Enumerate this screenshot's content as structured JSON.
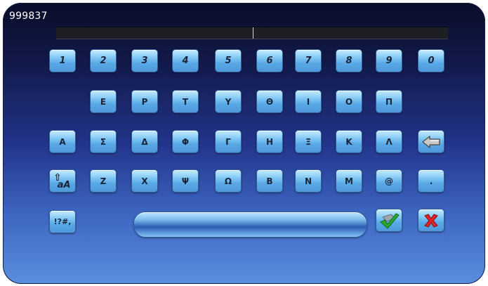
{
  "display": {
    "value": "999837"
  },
  "keyboard": {
    "row_digits": [
      "1",
      "2",
      "3",
      "4",
      "5",
      "6",
      "7",
      "8",
      "9",
      "0"
    ],
    "row_1": [
      "Ε",
      "Ρ",
      "Τ",
      "Υ",
      "Θ",
      "Ι",
      "Ο",
      "Π"
    ],
    "row_2": [
      "Α",
      "Σ",
      "Δ",
      "Φ",
      "Γ",
      "Η",
      "Ξ",
      "Κ",
      "Λ"
    ],
    "row_3": [
      "Ζ",
      "Χ",
      "Ψ",
      "Ω",
      "Β",
      "Ν",
      "Μ",
      "@",
      "."
    ],
    "shift_label": "aA",
    "symbols_label": "!?#,"
  },
  "icons": {
    "backspace": "arrow-left-icon",
    "shift": "shift-arrow-icon",
    "confirm": "checkmark-icon",
    "cancel": "red-x-icon"
  },
  "colors": {
    "key_top": "#c8ebff",
    "key_bottom": "#4f98da",
    "confirm_green": "#2aa635",
    "cancel_red": "#e0242a"
  }
}
